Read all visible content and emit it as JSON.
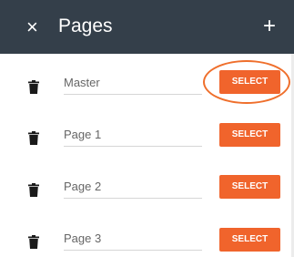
{
  "header": {
    "close_icon": "close-icon",
    "close_glyph": "×",
    "title": "Pages",
    "add_icon": "plus-icon",
    "add_glyph": "+",
    "background": "#343f4a"
  },
  "pages": [
    {
      "name": "Master",
      "select_label": "SELECT",
      "highlighted": true
    },
    {
      "name": "Page 1",
      "select_label": "SELECT",
      "highlighted": false
    },
    {
      "name": "Page 2",
      "select_label": "SELECT",
      "highlighted": false
    },
    {
      "name": "Page 3",
      "select_label": "SELECT",
      "highlighted": false
    }
  ],
  "icons": {
    "delete": "trash-icon"
  },
  "colors": {
    "accent": "#f0642c",
    "highlight_ring": "#ef6f2c",
    "text_muted": "#666666"
  }
}
